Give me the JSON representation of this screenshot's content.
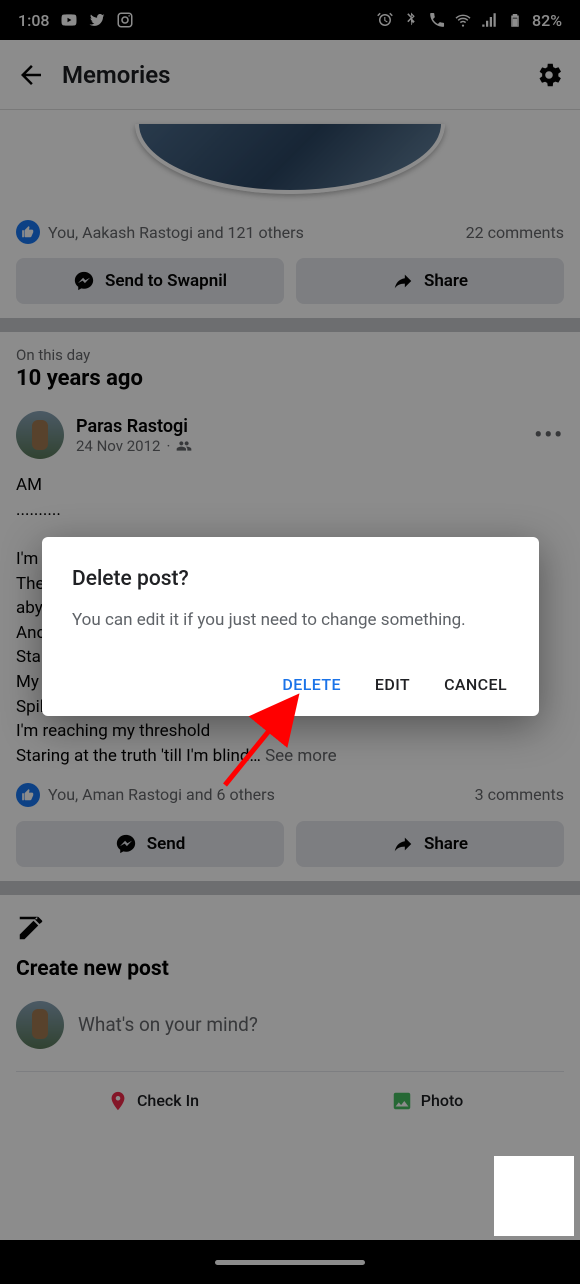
{
  "statusbar": {
    "time": "1:08",
    "battery": "82%"
  },
  "header": {
    "title": "Memories"
  },
  "post1": {
    "reactions_text": "You, Aakash Rastogi and 121 others",
    "comments": "22 comments",
    "send_label": "Send to Swapnil",
    "share_label": "Share"
  },
  "section": {
    "label": "On this day",
    "title": "10 years ago"
  },
  "post2": {
    "author": "Paras Rastogi",
    "date": "24 Nov 2012",
    "body": "AM\n..........\n\nI'm\nThe\naby\nAnd\nSta\nMy body's stupid, stereo puth.\nSpilling out music into raw sewage\nI'm reaching my threshold\nStaring at the truth 'till I'm blind… ",
    "see_more": "See more",
    "reactions_text": "You, Aman Rastogi and 6 others",
    "comments": "3 comments",
    "send_label": "Send",
    "share_label": "Share"
  },
  "create": {
    "title": "Create new post",
    "prompt": "What's on your mind?",
    "checkin": "Check In",
    "photo": "Photo"
  },
  "dialog": {
    "title": "Delete post?",
    "body": "You can edit it if you just need to change something.",
    "delete": "DELETE",
    "edit": "EDIT",
    "cancel": "CANCEL"
  }
}
